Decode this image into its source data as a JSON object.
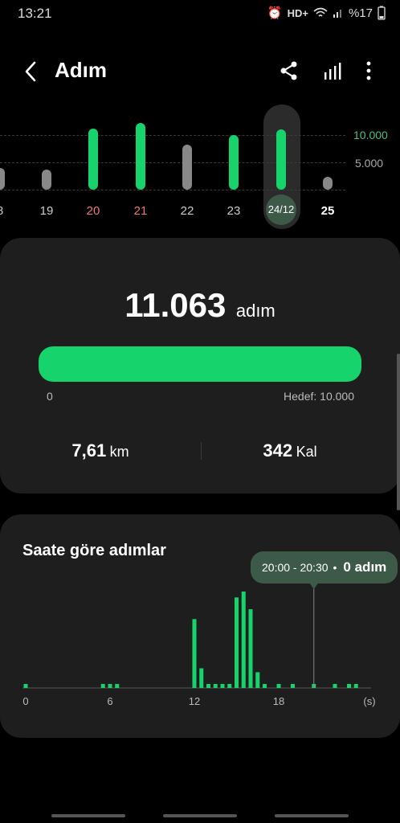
{
  "status": {
    "time": "13:21",
    "network": "HD+",
    "battery": "%17"
  },
  "header": {
    "title": "Adım"
  },
  "icons": {
    "back": "back-arrow-icon",
    "share": "share-icon",
    "stats": "bar-chart-icon",
    "more": "more-vertical-icon",
    "alarm": "alarm-icon",
    "wifi": "wifi-icon",
    "signal": "signal-icon",
    "battery": "battery-icon"
  },
  "week": {
    "y_labels": [
      "10.000",
      "5.000"
    ],
    "days": [
      {
        "label": "8",
        "steps": 4000,
        "goal_met": false,
        "color": "#888888"
      },
      {
        "label": "19",
        "steps": 3700,
        "goal_met": false,
        "color": "#888888"
      },
      {
        "label": "20",
        "steps": 11200,
        "goal_met": true,
        "color": "#17d36b"
      },
      {
        "label": "21",
        "steps": 12200,
        "goal_met": true,
        "color": "#17d36b"
      },
      {
        "label": "22",
        "steps": 8200,
        "goal_met": false,
        "color": "#888888"
      },
      {
        "label": "23",
        "steps": 10000,
        "goal_met": true,
        "color": "#17d36b"
      },
      {
        "label": "24/12",
        "steps": 11063,
        "goal_met": true,
        "color": "#17d36b",
        "selected": true
      },
      {
        "label": "25",
        "steps": 2400,
        "goal_met": false,
        "color": "#888888"
      }
    ]
  },
  "summary": {
    "steps": "11.063",
    "steps_unit": "adım",
    "progress": 1.0,
    "progress_min": "0",
    "goal_label": "Hedef: 10.000",
    "distance": "7,61",
    "distance_unit": "km",
    "calories": "342",
    "calories_unit": "Kal"
  },
  "hourly": {
    "title": "Saate göre adımlar",
    "tooltip_time": "20:00 - 20:30",
    "tooltip_dot": "•",
    "tooltip_value": "0 adım",
    "x_labels": [
      "0",
      "6",
      "12",
      "18",
      "(s)"
    ],
    "chart_data": {
      "type": "bar",
      "xlabel": "(s)",
      "x_range": [
        0,
        24
      ],
      "bins_hours": [
        0,
        5.5,
        6,
        6.5,
        12,
        12.5,
        13,
        13.5,
        14,
        14.5,
        15,
        15.5,
        16,
        16.5,
        17,
        18,
        19,
        20.5,
        22,
        23,
        23.5
      ],
      "values": [
        60,
        60,
        60,
        60,
        1750,
        500,
        60,
        60,
        60,
        60,
        2300,
        2450,
        2000,
        400,
        60,
        60,
        60,
        60,
        60,
        60,
        60
      ]
    }
  },
  "accent": "#17d36b",
  "highlight_day_color": "#f07878"
}
